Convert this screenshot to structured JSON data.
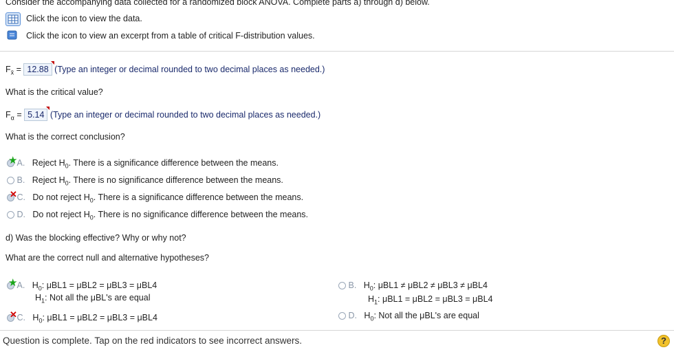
{
  "header": {
    "intro": "Consider the accompanying data collected for a randomized block ANOVA. Complete parts a) through d) below.",
    "data_link": "Click the icon to view the data.",
    "table_link": "Click the icon to view an excerpt from a table of critical F-distribution values."
  },
  "fstat": {
    "label": "F",
    "sub": "x̄",
    "value": "12.88",
    "hint": "(Type an integer or decimal rounded to two decimal places as needed.)"
  },
  "critical": {
    "question": "What is the critical value?",
    "label": "F",
    "sub": "α",
    "value": "5.14",
    "hint": "(Type an integer or decimal rounded to two decimal places as needed.)"
  },
  "conclusion": {
    "question": "What is the correct conclusion?",
    "options": [
      {
        "letter": "A.",
        "pre": "Reject H",
        "sub": "0",
        "post": ". There is a significance difference between the means."
      },
      {
        "letter": "B.",
        "pre": "Reject H",
        "sub": "0",
        "post": ". There is no significance difference between the means."
      },
      {
        "letter": "C.",
        "pre": "Do not reject H",
        "sub": "0",
        "post": ". There is a significance difference between the means."
      },
      {
        "letter": "D.",
        "pre": "Do not reject H",
        "sub": "0",
        "post": ". There is no significance difference between the means."
      }
    ]
  },
  "partd": {
    "heading": "d) Was the blocking effective? Why or why not?",
    "question": "What are the correct null and alternative hypotheses?",
    "A": {
      "letter": "A.",
      "h0": "H",
      "h0sub": "0",
      "h0rest": ": μBL1 = μBL2 = μBL3 = μBL4",
      "h1": "H",
      "h1sub": "1",
      "h1rest": ": Not all the μBL's are equal"
    },
    "B": {
      "letter": "B.",
      "h0": "H",
      "h0sub": "0",
      "h0rest": ": μBL1 ≠ μBL2 ≠ μBL3 ≠ μBL4",
      "h1": "H",
      "h1sub": "1",
      "h1rest": ": μBL1 = μBL2 = μBL3 = μBL4"
    },
    "C": {
      "letter": "C.",
      "h0": "H",
      "h0sub": "0",
      "h0rest": ": μBL1 = μBL2 = μBL3 = μBL4"
    },
    "D": {
      "letter": "D.",
      "h0": "H",
      "h0sub": "0",
      "h0rest": ": Not all the μBL's are equal"
    }
  },
  "footer": {
    "status": "Question is complete. Tap on the red indicators to see incorrect answers.",
    "help": "?"
  }
}
